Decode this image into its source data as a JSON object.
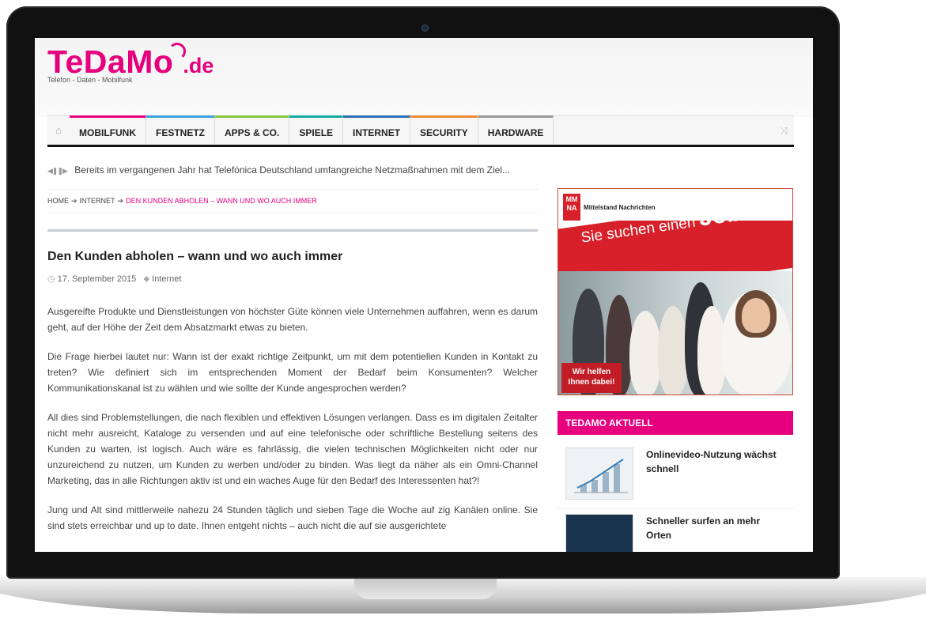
{
  "site": {
    "logo_main": "TeDaMo",
    "logo_tld": ".de",
    "tagline": "Telefon - Daten - Mobilfunk",
    "brand_color": "#e6007e"
  },
  "nav": {
    "home_icon": "home-icon",
    "items": [
      {
        "label": "MOBILFUNK",
        "color": "#e6007e"
      },
      {
        "label": "FESTNETZ",
        "color": "#3aa3d8"
      },
      {
        "label": "APPS & CO.",
        "color": "#8cc63f"
      },
      {
        "label": "SPIELE",
        "color": "#17a9a0"
      },
      {
        "label": "INTERNET",
        "color": "#2d6fb3"
      },
      {
        "label": "SECURITY",
        "color": "#f28c38"
      },
      {
        "label": "HARDWARE",
        "color": "#999999"
      }
    ],
    "shuffle_icon": "shuffle-icon"
  },
  "ticker": {
    "controls": "prev-pause-next",
    "text": "Bereits im vergangenen Jahr hat Telefónica Deutschland umfangreiche Netzmaßnahmen mit dem Ziel..."
  },
  "breadcrumb": {
    "home": "HOME",
    "category": "INTERNET",
    "current": "DEN KUNDEN ABHOLEN – WANN UND WO AUCH IMMER"
  },
  "article": {
    "title": "Den Kunden abholen – wann und wo auch immer",
    "date": "17. September 2015",
    "category": "Internet",
    "paragraphs": [
      "Ausgereifte Produkte und Dienstleistungen von höchster Güte können viele Unternehmen auffahren, wenn es darum geht, auf der Höhe der Zeit dem Absatzmarkt etwas zu bieten.",
      "Die Frage hierbei lautet nur: Wann ist der exakt richtige Zeitpunkt, um mit dem potentiellen Kunden in Kontakt zu treten? Wie definiert sich im entsprechenden Moment der Bedarf beim Konsumenten? Welcher Kommunikationskanal ist zu wählen und wie sollte der Kunde angesprochen werden?",
      "All dies sind Problemstellungen, die nach flexiblen und effektiven Lösungen verlangen. Dass es im digitalen Zeitalter nicht mehr ausreicht, Kataloge zu versenden und auf eine telefonische oder schriftliche Bestellung seitens des Kunden zu warten, ist logisch. Auch wäre es fahrlässig, die vielen technischen Möglichkeiten nicht oder nur unzureichend zu nutzen, um Kunden zu werben und/oder zu binden. Was liegt da näher als ein Omni-Channel Marketing, das in alle Richtungen aktiv ist und ein waches Auge für den Bedarf des Interessenten hat?!",
      "Jung und Alt sind mittlerweile nahezu 24 Stunden täglich und sieben Tage die Woche auf zig Kanälen online. Sie sind stets erreichbar und up to date. Ihnen entgeht nichts – auch nicht die auf sie ausgerichtete"
    ]
  },
  "ad": {
    "logo_letters": "MM NA",
    "logo_text": "Mittelstand Nachrichten",
    "slogan_pre": "Sie suchen einen",
    "slogan_big": "Job?",
    "help_text": "Wir helfen Ihnen dabei!",
    "accent": "#d8202a"
  },
  "sidebar": {
    "section_title": "TEDAMO AKTUELL",
    "news": [
      {
        "title": "Onlinevideo-Nutzung wächst schnell",
        "thumb": "chart"
      },
      {
        "title": "Schneller surfen an mehr Orten",
        "thumb": "dark"
      }
    ]
  }
}
